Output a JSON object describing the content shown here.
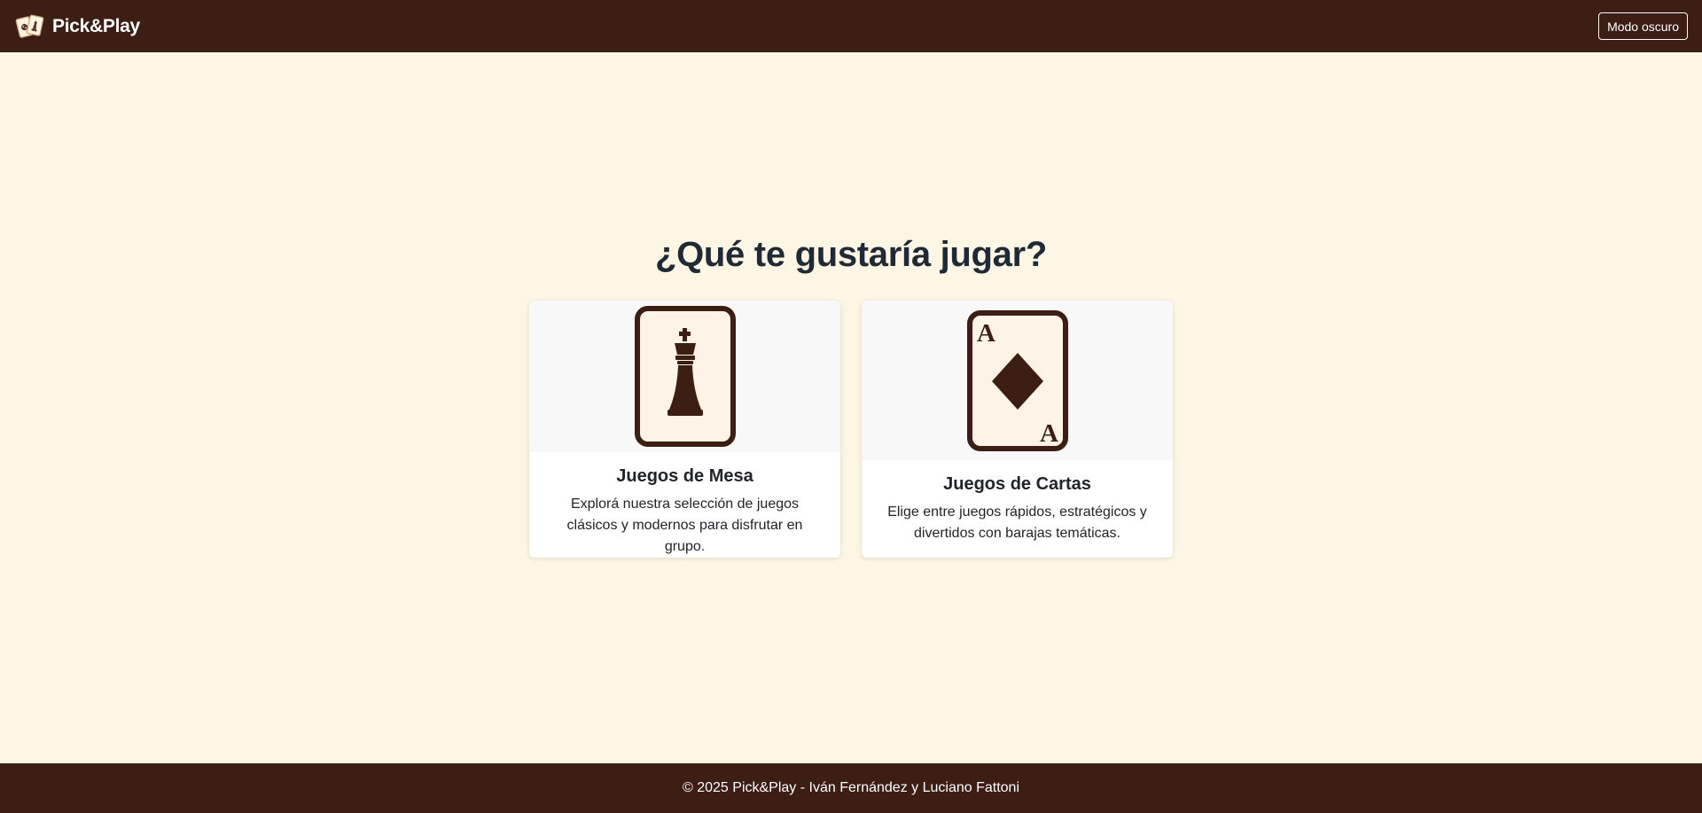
{
  "navbar": {
    "brand_name": "Pick&Play",
    "logo_icon": "playing-cards-logo-icon",
    "theme_toggle_label": "Modo oscuro"
  },
  "main": {
    "title": "¿Qué te gustaría jugar?",
    "cards": [
      {
        "icon": "chess-king-card-icon",
        "title": "Juegos de Mesa",
        "text": "Explorá nuestra selección de juegos clásicos y modernos para disfrutar en grupo."
      },
      {
        "icon": "ace-of-diamonds-card-icon",
        "title": "Juegos de Cartas",
        "text": "Elige entre juegos rápidos, estratégicos y divertidos con barajas temáticas.",
        "corner_label": "A"
      }
    ]
  },
  "footer": {
    "text": "© 2025 Pick&Play - Iván Fernández y Luciano Fattoni"
  },
  "colors": {
    "navbar_bg": "#3c1e14",
    "page_bg": "#fef6e4",
    "icon_brown": "#3c1e14",
    "card_image_bg": "#f8f8f8"
  }
}
